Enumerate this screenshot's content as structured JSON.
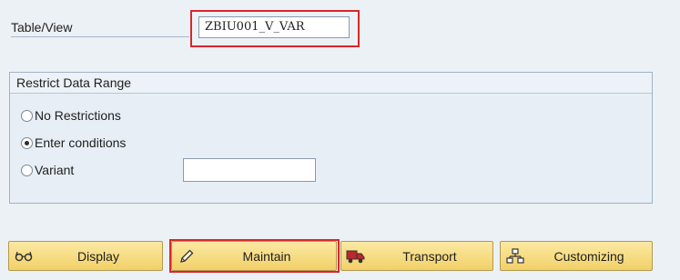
{
  "table_view": {
    "label": "Table/View",
    "value": "ZBIU001_V_VAR"
  },
  "restrict": {
    "title": "Restrict Data Range",
    "options": [
      {
        "label": "No Restrictions",
        "selected": false
      },
      {
        "label": "Enter conditions",
        "selected": true
      },
      {
        "label": "Variant",
        "selected": false
      }
    ],
    "variant_value": ""
  },
  "buttons": {
    "display": "Display",
    "maintain": "Maintain",
    "transport": "Transport",
    "customizing": "Customizing"
  },
  "colors": {
    "highlight": "#d9262b",
    "button": "#f2d068",
    "background": "#ecf1f6"
  },
  "icons": {
    "display": "glasses-icon",
    "maintain": "pencil-icon",
    "transport": "truck-icon",
    "customizing": "hierarchy-icon"
  }
}
